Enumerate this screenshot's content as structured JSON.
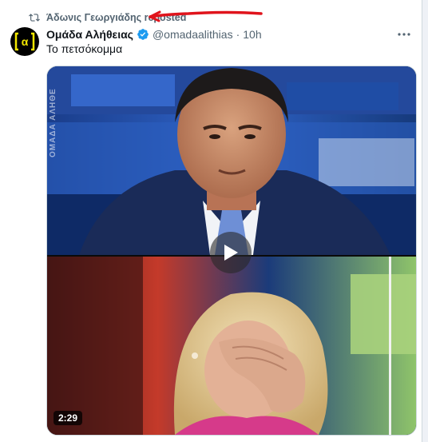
{
  "repost": {
    "text": "Άδωνις Γεωργιάδης reposted",
    "icon": "repost-icon"
  },
  "tweet": {
    "author_name": "Ομάδα Αλήθειας",
    "handle": "@omadaalithias",
    "separator": "·",
    "time": "10h",
    "text": "Το πετσόκομμα",
    "avatar_logo": "[α]",
    "verified_icon": "verified-badge-icon",
    "more_icon": "more-options-icon"
  },
  "media": {
    "duration": "2:29",
    "watermark": "ΟΜΑΔΑ ΑΛΗΘΕ",
    "play_icon": "play-icon"
  },
  "colors": {
    "text_primary": "#0f1419",
    "text_secondary": "#536471",
    "verified_blue": "#1d9bf0",
    "annotation_red": "#e0141c",
    "avatar_bg": "#000000",
    "avatar_logo": "#f2e600"
  }
}
